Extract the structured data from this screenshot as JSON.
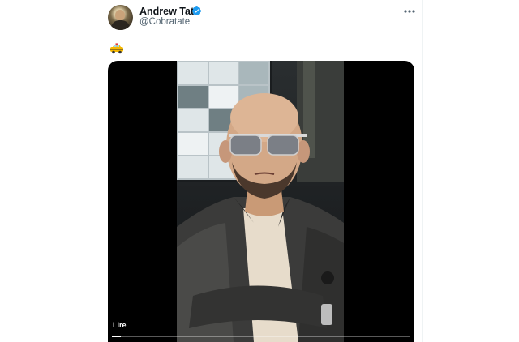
{
  "tweet": {
    "display_name": "Andrew Tate",
    "handle": "@Cobratate",
    "verified": true,
    "text_emoji": "🚕",
    "more_icon": "more-horizontal-icon"
  },
  "media": {
    "type": "video",
    "play_label": "Lire",
    "progress": 0.03
  },
  "colors": {
    "name": "#0f1419",
    "handle": "#536471",
    "verified": "#1d9bf0",
    "media_bg": "#000000"
  }
}
